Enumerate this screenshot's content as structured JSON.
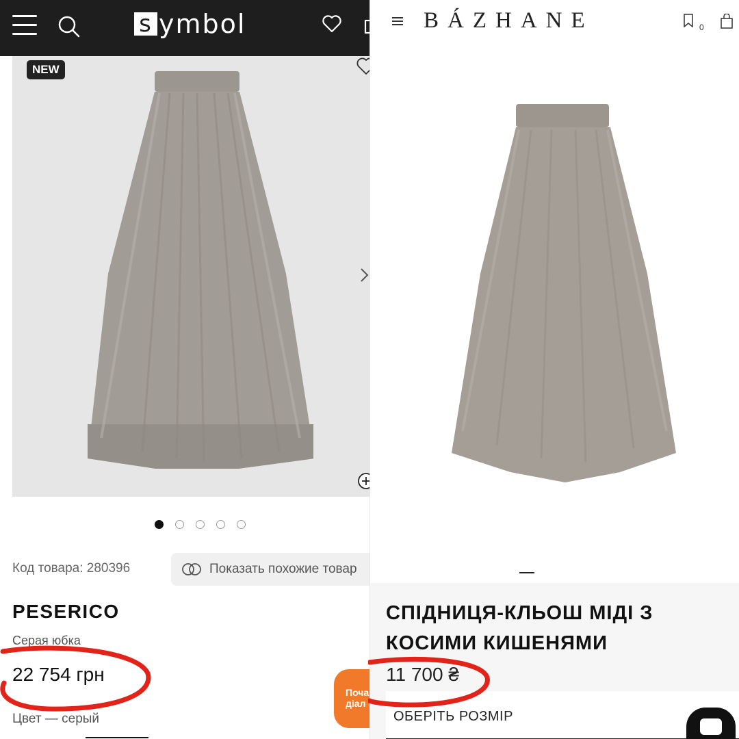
{
  "left": {
    "logo_letter": "s",
    "logo_rest": "ymbol",
    "badge": "NEW",
    "sku": "Код товара: 280396",
    "similar_button": "Показать похожие товар",
    "brand": "PESERICO",
    "subtitle": "Серая юбка",
    "price": "22 754 грн",
    "color": "Цвет — серый",
    "chat_line1": "Поча",
    "chat_line2": "діал",
    "gallery": {
      "total": 5,
      "active": 1
    }
  },
  "right": {
    "logo": "BÁZHANE",
    "wishlist_count": "0",
    "title": "СПІДНИЦЯ-КЛЬОШ МІДІ З КОСИМИ КИШЕНЯМИ",
    "price": "11 700 ₴",
    "size_button": "ОБЕРІТЬ РОЗМІР"
  },
  "colors": {
    "highlight": "#e2231a",
    "orange": "#f07a2a",
    "skirt": "#a29c96",
    "header_dark": "#1e1e1e"
  }
}
